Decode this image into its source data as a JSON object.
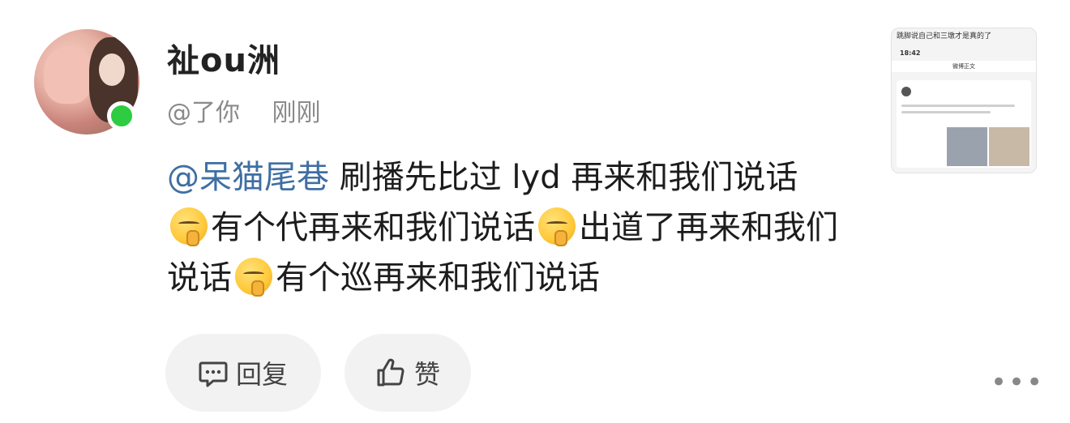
{
  "comment": {
    "user_name": "祉ou洲",
    "handle": "@了你",
    "time": "刚刚",
    "mention": "@呆猫尾巷",
    "segments": [
      " 刷播先比过 lyd 再来和我们说话",
      "有个代再来和我们说话",
      "出道了再来和我们说话",
      "有个巡再来和我们说话"
    ],
    "emoji": "shushing-face-icon"
  },
  "thumbnail": {
    "top_text": "跳脚说自己和三墩才是真的了",
    "status_time": "18:42",
    "nav_title": "微博正文"
  },
  "actions": {
    "reply_label": "回复",
    "like_label": "赞",
    "more_label": "•••"
  },
  "colors": {
    "mention": "#3f6fa3",
    "online": "#2ecc40",
    "button_bg": "#f2f2f2"
  }
}
